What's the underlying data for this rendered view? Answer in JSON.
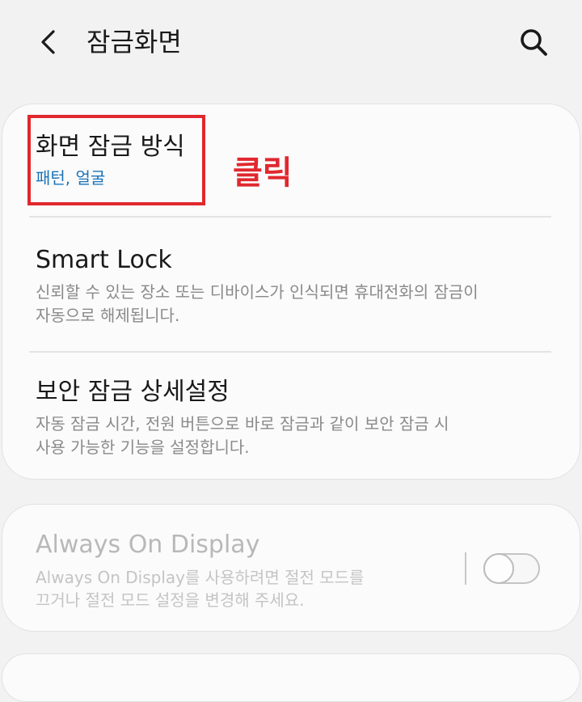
{
  "header": {
    "title": "잠금화면",
    "back_icon": "chevron-left-icon",
    "search_icon": "search-icon"
  },
  "settings": {
    "lock_type": {
      "title": "화면 잠금 방식",
      "subtitle": "패턴, 얼굴"
    },
    "smart_lock": {
      "title": "Smart Lock",
      "subtitle_line1": "신뢰할 수 있는 장소 또는 디바이스가 인식되면 휴대전화의 잠금이",
      "subtitle_line2": "자동으로 해제됩니다."
    },
    "secure_lock": {
      "title": "보안 잠금 상세설정",
      "subtitle_line1": "자동 잠금 시간, 전원 버튼으로 바로 잠금과 같이 보안 잠금 시",
      "subtitle_line2": "사용 가능한 기능을 설정합니다."
    },
    "always_on_display": {
      "title": "Always On Display",
      "subtitle_line1": "Always On Display를 사용하려면 절전 모드를",
      "subtitle_line2": "끄거나 절전 모드 설정을 변경해 주세요.",
      "enabled": false,
      "toggle_on": false
    }
  },
  "annotation": {
    "label": "클릭",
    "color": "#e0282e"
  },
  "colors": {
    "background": "#f2f2f2",
    "card": "#fbfbfb",
    "accent_blue": "#1a73b8",
    "annotation_red": "#e0282e"
  }
}
